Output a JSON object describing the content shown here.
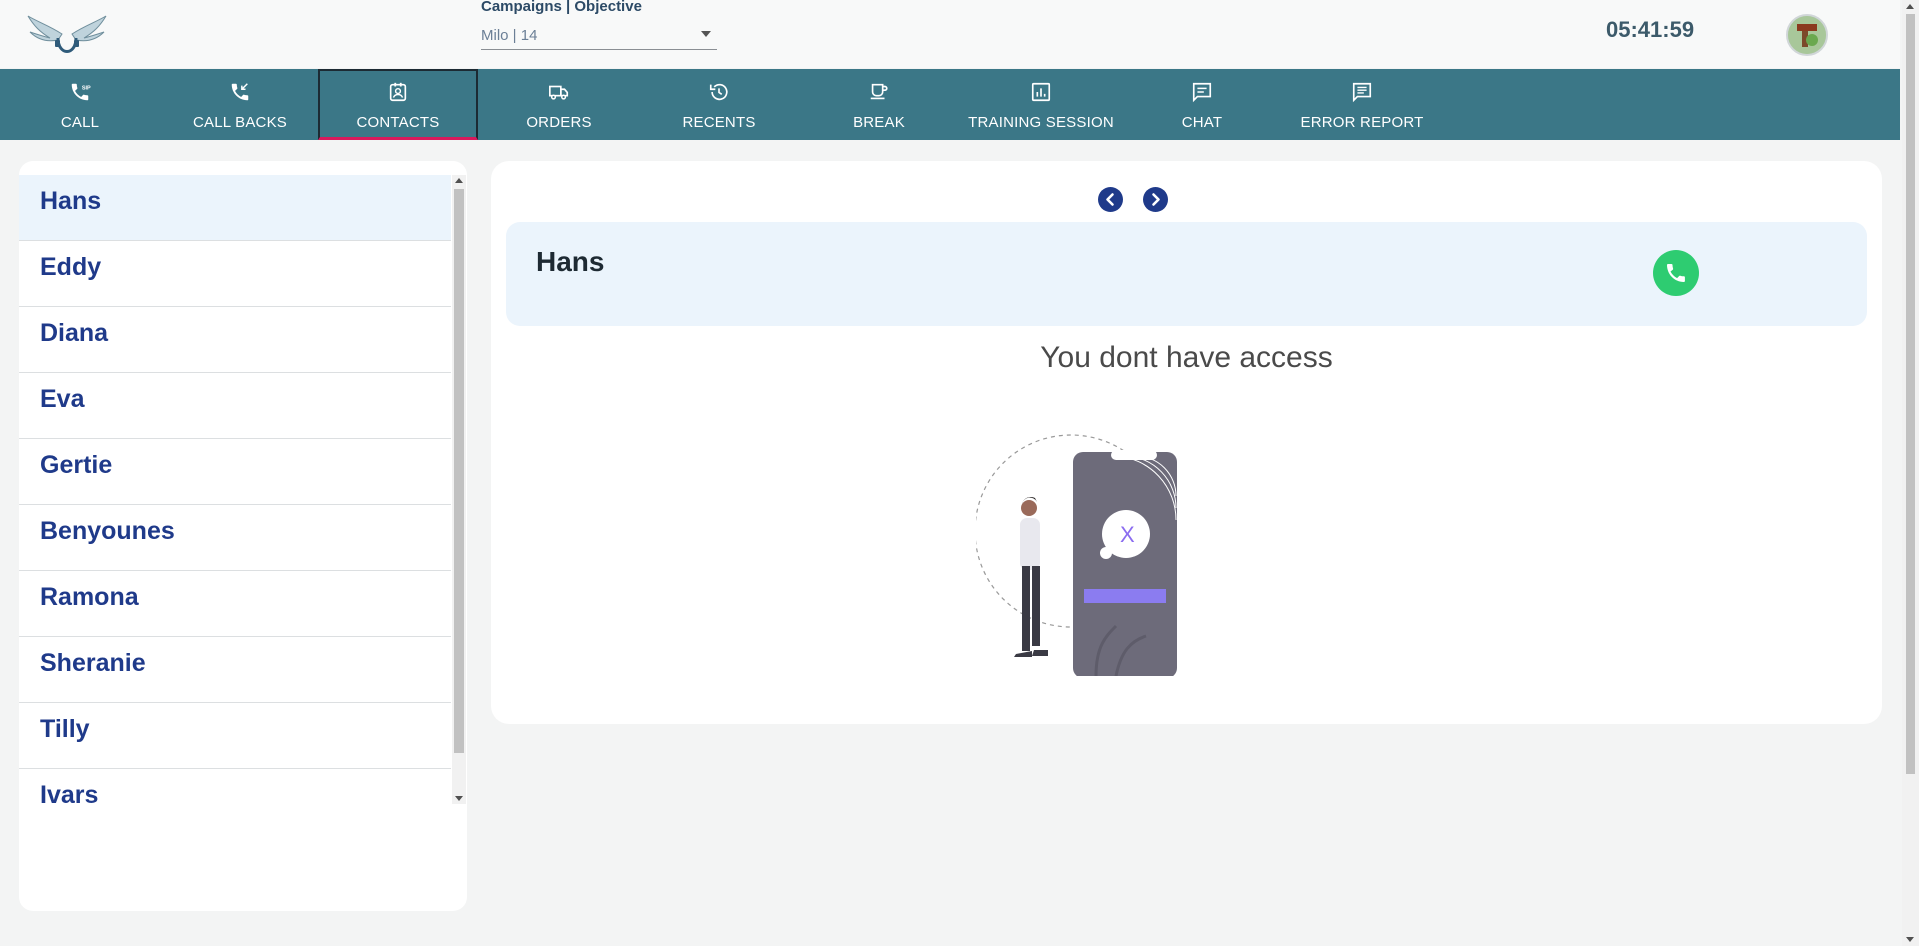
{
  "header": {
    "campaign_title": "Campaigns | Objective",
    "campaign_value": "Milo | 14",
    "clock": "05:41:59"
  },
  "nav": [
    {
      "label": "CALL",
      "icon": "phone-sip-icon"
    },
    {
      "label": "CALL BACKS",
      "icon": "phone-callback-icon"
    },
    {
      "label": "CONTACTS",
      "icon": "contacts-icon",
      "active": true
    },
    {
      "label": "ORDERS",
      "icon": "truck-icon"
    },
    {
      "label": "RECENTS",
      "icon": "history-icon"
    },
    {
      "label": "BREAK",
      "icon": "coffee-icon"
    },
    {
      "label": "TRAINING SESSION",
      "icon": "chart-icon"
    },
    {
      "label": "CHAT",
      "icon": "chat-icon"
    },
    {
      "label": "ERROR REPORT",
      "icon": "message-icon"
    }
  ],
  "contacts": [
    "Hans",
    "Eddy",
    "Diana",
    "Eva",
    "Gertie",
    "Benyounes",
    "Ramona",
    "Sheranie",
    "Tilly",
    "Ivars"
  ],
  "detail": {
    "name": "Hans",
    "message": "You dont have access"
  },
  "colors": {
    "nav_bg": "#3b7787",
    "accent": "#1f3a8a",
    "call_green": "#2ecc71",
    "active_underline": "#d8195c"
  }
}
